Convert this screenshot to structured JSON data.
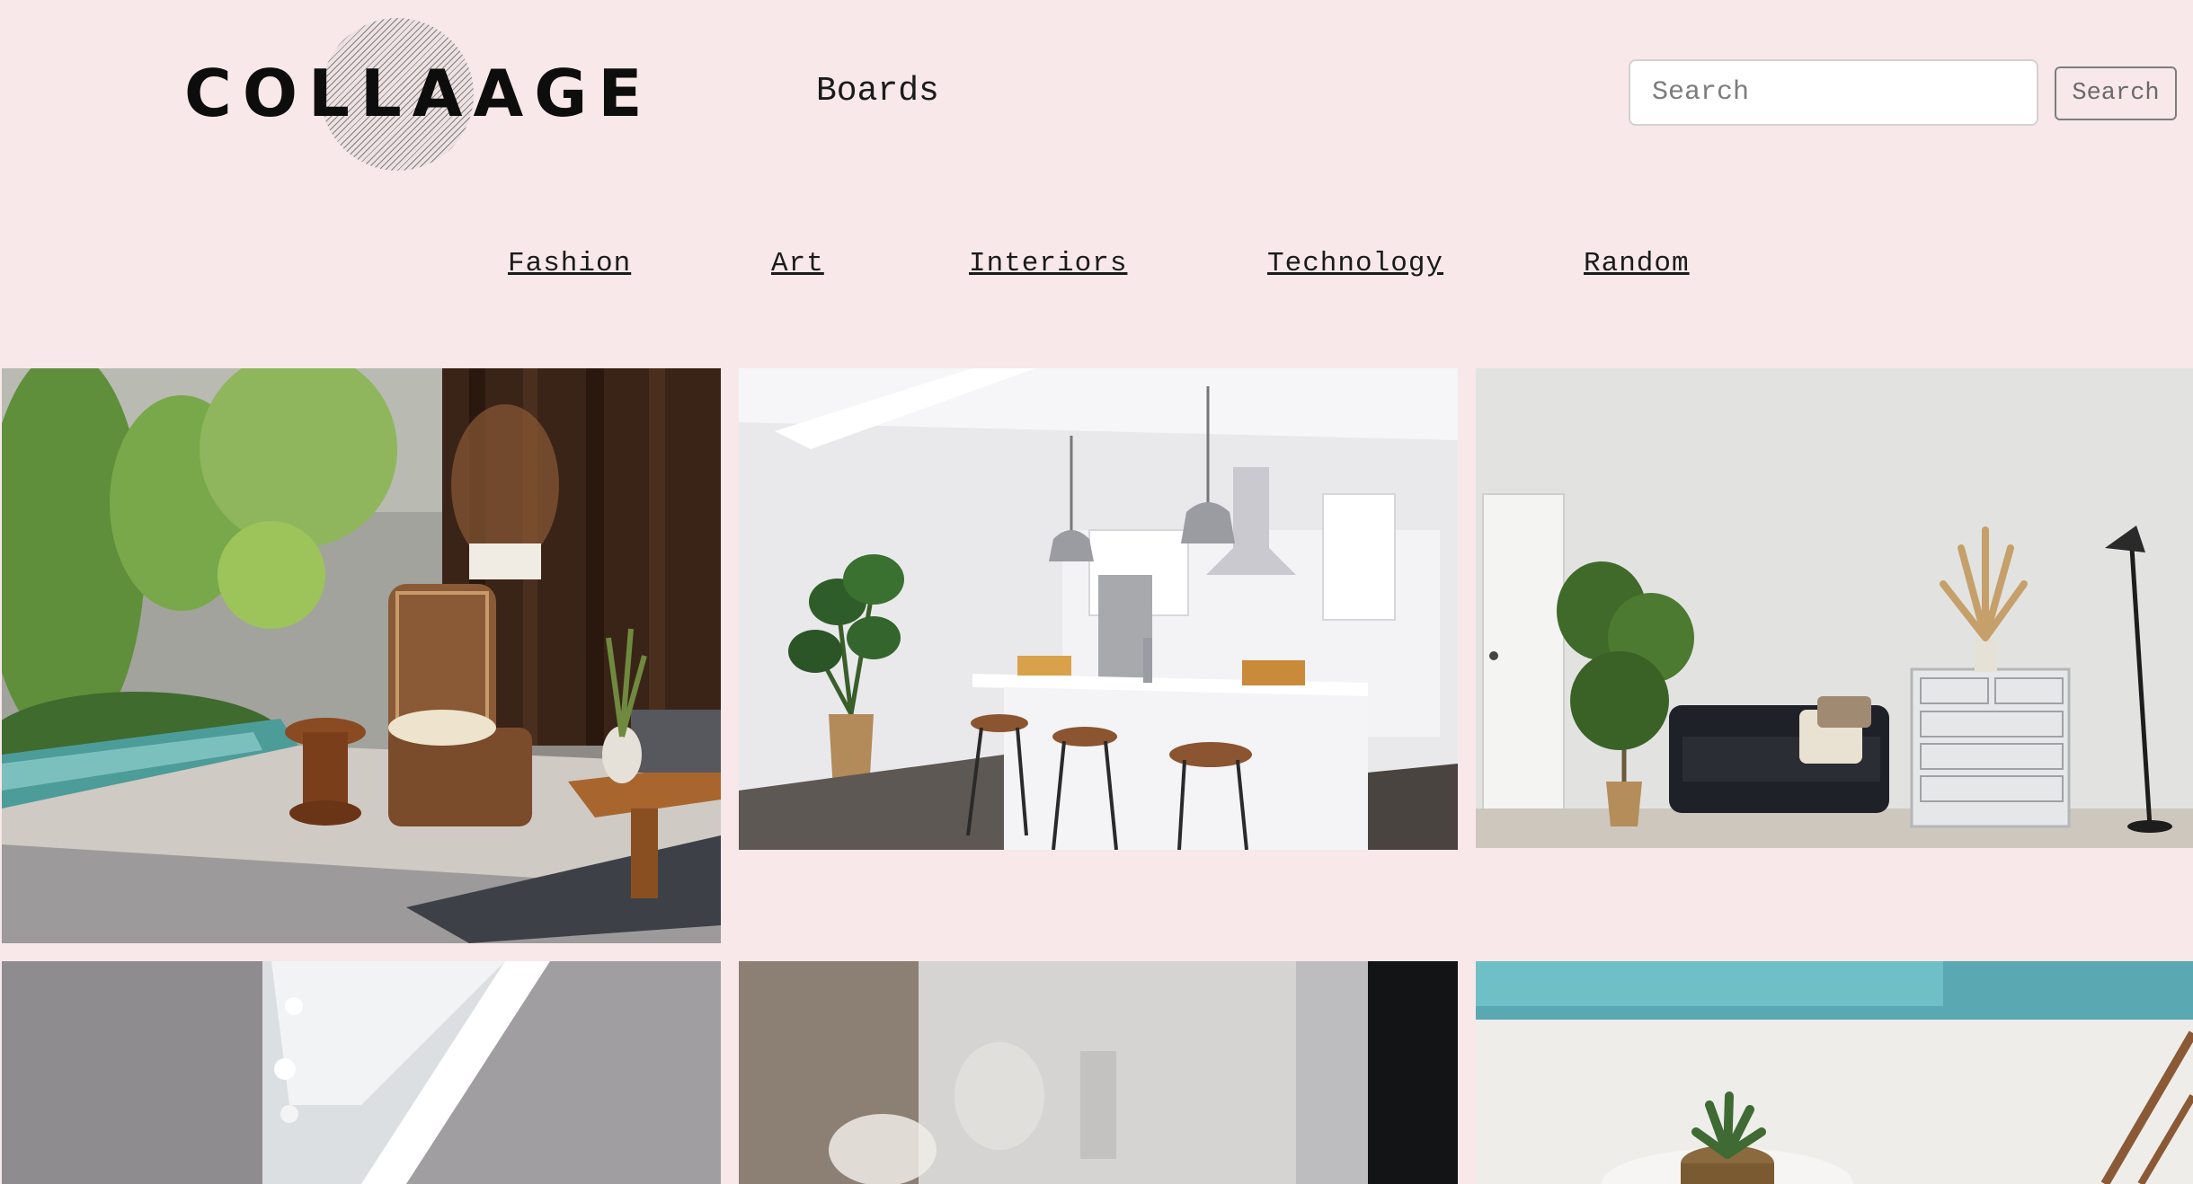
{
  "brand": {
    "logo_text": "COLLAAGE"
  },
  "header": {
    "boards_label": "Boards",
    "search": {
      "placeholder": "Search",
      "value": "",
      "button_label": "Search"
    }
  },
  "categories": [
    {
      "label": "Fashion"
    },
    {
      "label": "Art"
    },
    {
      "label": "Interiors"
    },
    {
      "label": "Technology"
    },
    {
      "label": "Random"
    }
  ],
  "gallery": {
    "tiles": [
      {
        "depicts": "patio-lounge-photo"
      },
      {
        "depicts": "kitchen-island-photo"
      },
      {
        "depicts": "living-room-sofa-photo"
      },
      {
        "depicts": "skylight-ceiling-photo"
      },
      {
        "depicts": "blurred-interior-photo"
      },
      {
        "depicts": "poolside-succulent-photo"
      }
    ]
  },
  "colors": {
    "background": "#f8e8e9",
    "text": "#1b1b1b",
    "button_border": "#7d7d7d"
  }
}
